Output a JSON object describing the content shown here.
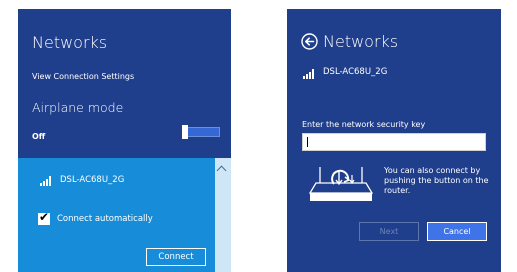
{
  "left_panel": {
    "title": "Networks",
    "view_connection_settings": "View Connection Settings",
    "airplane_mode_label": "Airplane mode",
    "airplane_mode_state": "Off",
    "network": {
      "name": "DSL-AC68U_2G",
      "connect_automatically_label": "Connect automatically",
      "connect_automatically_checked": true,
      "connect_button": "Connect"
    }
  },
  "right_panel": {
    "title": "Networks",
    "network_name": "DSL-AC68U_2G",
    "security_key_label": "Enter the network security key",
    "security_key_value": "",
    "push_button_hint": "You can also connect by pushing the button on the router.",
    "next_button": "Next",
    "cancel_button": "Cancel"
  },
  "colors": {
    "panel_background": "#1f3e8c",
    "network_highlight": "#178cd8",
    "accent_button": "#3f74e8"
  },
  "icons": [
    "wifi-signal-icon",
    "back-arrow-icon",
    "router-wps-icon",
    "checkmark-icon",
    "scroll-up-icon"
  ]
}
